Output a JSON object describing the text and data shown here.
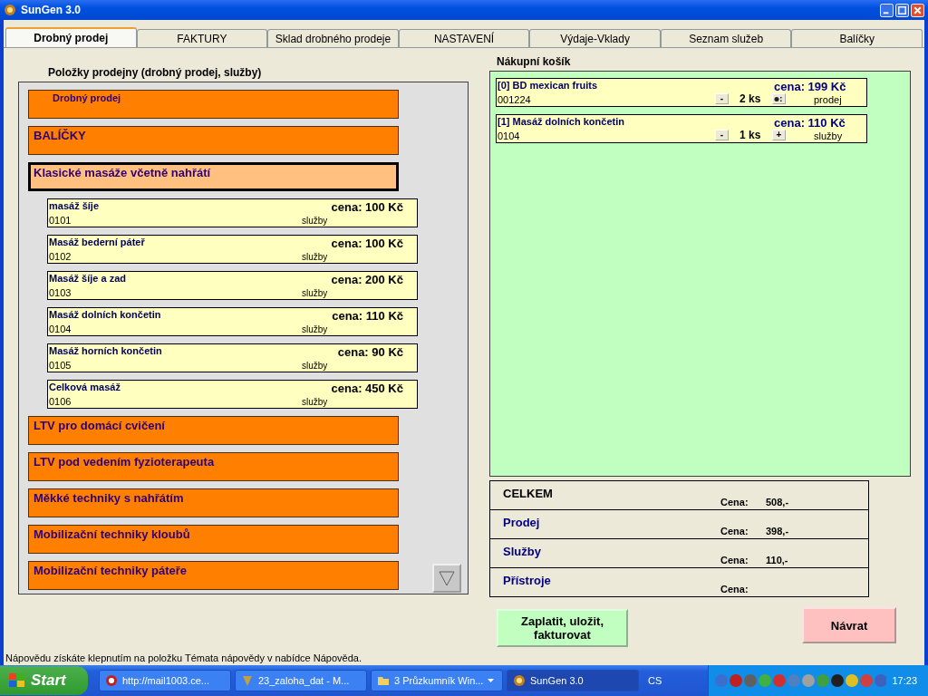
{
  "window": {
    "title": "SunGen 3.0"
  },
  "tabs": [
    {
      "label": "Drobný prodej",
      "selected": true
    },
    {
      "label": "FAKTURY",
      "selected": false
    },
    {
      "label": "Sklad drobného prodeje",
      "selected": false
    },
    {
      "label": "NASTAVENÍ",
      "selected": false
    },
    {
      "label": "Výdaje-Vklady",
      "selected": false
    },
    {
      "label": "Seznam služeb",
      "selected": false
    },
    {
      "label": "Balíčky",
      "selected": false
    }
  ],
  "items_panel": {
    "title": "Položky prodejny (drobný prodej, služby)",
    "categories": [
      {
        "kind": "header",
        "label": "Drobný prodej",
        "expanded": false
      },
      {
        "kind": "category",
        "label": "BALÍČKY",
        "expanded": false
      },
      {
        "kind": "category",
        "label": "Klasické masáže včetně nahřátí",
        "expanded": true,
        "children": [
          {
            "name": "masáž šíje",
            "code": "0101",
            "price": "cena: 100 Kč",
            "type": "služby"
          },
          {
            "name": "Masáž bederní páteř",
            "code": "0102",
            "price": "cena: 100 Kč",
            "type": "služby"
          },
          {
            "name": "Masáž šíje a zad",
            "code": "0103",
            "price": "cena: 200 Kč",
            "type": "služby"
          },
          {
            "name": "Masáž dolních končetin",
            "code": "0104",
            "price": "cena: 110 Kč",
            "type": "služby"
          },
          {
            "name": "Masáž horních končetin",
            "code": "0105",
            "price": "cena: 90 Kč",
            "type": "služby"
          },
          {
            "name": "Celková masáž",
            "code": "0106",
            "price": "cena: 450 Kč",
            "type": "služby"
          }
        ]
      },
      {
        "kind": "category",
        "label": "LTV pro domácí cvičení",
        "expanded": false
      },
      {
        "kind": "category",
        "label": "LTV pod vedením fyzioterapeuta",
        "expanded": false
      },
      {
        "kind": "category",
        "label": "Měkké techniky s nahřátím",
        "expanded": false
      },
      {
        "kind": "category",
        "label": "Mobilizační techniky kloubů",
        "expanded": false
      },
      {
        "kind": "category",
        "label": "Mobilizační techniky páteře",
        "expanded": false
      }
    ]
  },
  "cart": {
    "title": "Nákupní košík",
    "items": [
      {
        "name": "[0] BD mexican fruits",
        "code": "001224",
        "price": "cena: 199 Kč",
        "minus": "-",
        "quantity": "2 ks",
        "kind": "icon",
        "type": "prodej"
      },
      {
        "name": "[1] Masáž dolních končetin",
        "code": "0104",
        "price": "cena: 110 Kč",
        "minus": "-",
        "quantity": "1 ks",
        "kind": "plus",
        "plus": "+",
        "type": "služby"
      }
    ]
  },
  "totals": [
    {
      "kind": "total",
      "label": "CELKEM",
      "price_label": "Cena:",
      "value": "508,-"
    },
    {
      "kind": "group",
      "label": "Prodej",
      "price_label": "Cena:",
      "value": "398,-"
    },
    {
      "kind": "group",
      "label": "Služby",
      "price_label": "Cena:",
      "value": "110,-"
    },
    {
      "kind": "group",
      "label": "Přístroje",
      "price_label": "Cena:"
    }
  ],
  "buttons": {
    "pay": "Zaplatit, uložit, fakturovat",
    "back": "Návrat"
  },
  "status_bar": "Nápovědu získáte klepnutím na položku Témata nápovědy v nabídce Nápověda.",
  "taskbar": {
    "start": "Start",
    "tasks": [
      {
        "label": "http://mail1003.ce...",
        "selected": false,
        "kind": "browser"
      },
      {
        "label": "23_zaloha_dat - M...",
        "selected": false,
        "kind": "app"
      },
      {
        "label": "3 Průzkumník Win...",
        "selected": false,
        "kind": "folder"
      },
      {
        "label": "SunGen 3.0",
        "selected": true,
        "kind": "sun"
      }
    ],
    "language": "CS",
    "clock": "17:23"
  }
}
